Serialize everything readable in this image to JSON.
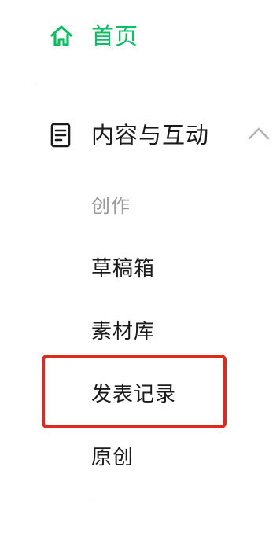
{
  "sidebar": {
    "home": {
      "label": "首页",
      "icon": "home-icon",
      "color": "#07c160"
    },
    "section": {
      "label": "内容与互动",
      "icon": "document-icon",
      "toggle_icon": "chevron-up-icon"
    },
    "group": {
      "label": "创作"
    },
    "items": [
      {
        "label": "草稿箱"
      },
      {
        "label": "素材库"
      },
      {
        "label": "发表记录",
        "highlighted": true
      },
      {
        "label": "原创"
      }
    ]
  },
  "colors": {
    "accent": "#07c160",
    "highlight_box": "#e0281e",
    "text": "#1a1a1a",
    "muted": "#9b9b9b"
  }
}
